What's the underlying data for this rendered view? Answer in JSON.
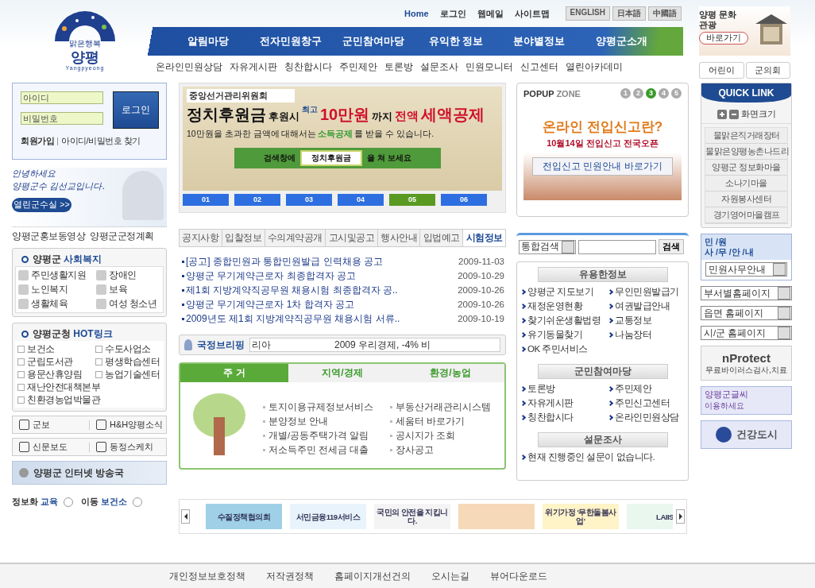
{
  "header": {
    "logo": {
      "slogan": "맑은행복",
      "name": "양평",
      "roman": "Yangpyeong"
    },
    "top_links": [
      "Home",
      "로그인",
      "웹메일",
      "사이트맵"
    ],
    "languages": [
      "ENGLISH",
      "日本語",
      "中國語"
    ],
    "main_menu": [
      "알림마당",
      "전자민원창구",
      "군민참여마당",
      "유익한 정보",
      "분야별정보",
      "양평군소개"
    ],
    "sub_menu": [
      "온라인민원상담",
      "자유게시판",
      "칭찬합시다",
      "주민제안",
      "토론방",
      "설문조사",
      "민원모니터",
      "신고센터",
      "열린아카데미"
    ],
    "culture": {
      "title": "양평 문화관광",
      "button": "바로가기"
    },
    "quick_buttons": [
      "어린이",
      "군의회"
    ]
  },
  "login": {
    "id_placeholder": "아이디",
    "pw_placeholder": "비밀번호",
    "button": "로그인",
    "join": "회원가입",
    "find": "아이디/비밀번호 찾기"
  },
  "mayor": {
    "line_1": "안녕하세요",
    "line_2": "양평군수 김선교입니다.",
    "button": "열린군수실 >>"
  },
  "promo_links": [
    "양평군홍보동영상",
    "양평군군정계획"
  ],
  "welfare": {
    "prefix": "양평군",
    "title": "사회복지",
    "items": [
      "주민생활지원",
      "장애인",
      "노인복지",
      "보육",
      "생활체육",
      "여성 청소년"
    ]
  },
  "hot_links": {
    "prefix": "양평군청",
    "title": "HOT링크",
    "items": [
      "보건소",
      "수도사업소",
      "군립도서관",
      "평생학습센터",
      "용문산휴양림",
      "농업기술센터",
      "재난안전대책본부",
      "친환경농업박물관"
    ]
  },
  "news_buttons": [
    "군보",
    "H&H양평소식",
    "신문보도",
    "동정스케치"
  ],
  "broadcast": "양평군 인터넷 방송국",
  "bottom_links": [
    {
      "prefix": "정보화",
      "label": "교육"
    },
    {
      "prefix": "이동",
      "label": "보건소"
    }
  ],
  "main_banner": {
    "org": "중앙선거관리위원회",
    "head_1": "정치후원금",
    "head_2": "후원시",
    "head_3": "최고",
    "head_4": "10만원",
    "head_5": "까지",
    "head_6": "전액",
    "head_7": "세액공제",
    "sub_1": "10만원을 초과한 금액에 대해서는",
    "sub_2": "소득공제",
    "sub_3": "를 받을 수 있습니다.",
    "search_1": "검색창에",
    "search_word": "정치후원금",
    "search_2": "을 쳐 보세요",
    "pages": [
      {
        "label": "01",
        "selected": false
      },
      {
        "label": "02",
        "selected": false
      },
      {
        "label": "03",
        "selected": false
      },
      {
        "label": "04",
        "selected": false
      },
      {
        "label": "05",
        "selected": true
      },
      {
        "label": "06",
        "selected": false
      }
    ]
  },
  "board": {
    "tabs": [
      {
        "label": "공지사항",
        "selected": false
      },
      {
        "label": "입찰정보",
        "selected": false
      },
      {
        "label": "수의계약공개",
        "selected": false
      },
      {
        "label": "고시및공고",
        "selected": false
      },
      {
        "label": "행사안내",
        "selected": false
      },
      {
        "label": "입법예고",
        "selected": false
      },
      {
        "label": "시험정보",
        "selected": true
      }
    ],
    "posts": [
      {
        "title": "[공고] 종합민원과 통합민원발급 인력채용 공고",
        "date": "2009-11-03"
      },
      {
        "title": "양평군 무기계약근로자 최종합격자 공고",
        "date": "2009-10-29"
      },
      {
        "title": "제1회 지방계약직공무원 채용시험 최종합격자 공..",
        "date": "2009-10-26"
      },
      {
        "title": "양평군 무기계약근로자 1차 합격자 공고",
        "date": "2009-10-26"
      },
      {
        "title": "2009년도 제1회 지방계약직공무원 채용시험 서류..",
        "date": "2009-10-19"
      }
    ]
  },
  "briefing": {
    "label": "국정브리핑",
    "ticker_1": "리아",
    "ticker_2": "2009 우리경제, -4% 비"
  },
  "themes": {
    "tabs": [
      {
        "label": "주 거",
        "selected": true
      },
      {
        "label": "지역/경제",
        "selected": false
      },
      {
        "label": "환경/농업",
        "selected": false
      }
    ],
    "links": [
      "토지이용규제정보서비스",
      "부동산거래관리시스템",
      "분양정보 안내",
      "세움터 바로가기",
      "개별/공동주택가격 알림",
      "공시지가 조회",
      "저소득주민 전세금 대출",
      "장사공고"
    ]
  },
  "popup": {
    "title_1": "POPUP",
    "title_2": "ZONE",
    "pages": [
      {
        "label": "1",
        "selected": false
      },
      {
        "label": "2",
        "selected": false
      },
      {
        "label": "3",
        "selected": true
      },
      {
        "label": "4",
        "selected": false
      },
      {
        "label": "5",
        "selected": false
      }
    ],
    "headline": "온라인 전입신고란?",
    "subline": "10월14일 전입신고 전국오픈",
    "link": "전입신고 민원안내 바로가기"
  },
  "search": {
    "scope": "통합검색",
    "button": "검색"
  },
  "info_sections": [
    {
      "title": "유용한정보",
      "links": [
        "양평군 지도보기",
        "무인민원발급기",
        "재정운영현황",
        "여권발급안내",
        "찾기쉬운생활법령",
        "교통정보",
        "유기동물찾기",
        "나눔장터",
        "OK 주민서비스"
      ]
    },
    {
      "title": "군민참여마당",
      "links": [
        "토론방",
        "주민제안",
        "자유게시판",
        "주민신고센터",
        "칭찬합시다",
        "온라인민원상담"
      ]
    },
    {
      "title": "설문조사",
      "links": [
        "현재 진행중인 설문이 없습니다."
      ]
    }
  ],
  "quick_link": {
    "title": "QUICK LINK",
    "zoom_label": "화면크기",
    "items": [
      "물맑은직거래장터",
      "물맑은양평농촌나드리",
      "양평군 정보화마을",
      "소나기마을",
      "자원봉사센터",
      "경기영어마을캠프"
    ]
  },
  "civil": {
    "title_1": "민 /원",
    "title_2": "사 /무 /안 /내",
    "select": "민원사무안내"
  },
  "selects": [
    "부서별홈페이지",
    "읍면 홈페이지",
    "시/군 홈페이지"
  ],
  "nprotect": {
    "name": "nProtect",
    "caption": "무료바이러스검사,치료"
  },
  "font_banner": {
    "title": "양평군글씨",
    "caption": "이용하세요"
  },
  "health_city": "건강도시",
  "banner_strip": [
    {
      "kind": "text",
      "text": "수질정책협의회"
    },
    {
      "kind": "text",
      "text": "서민금융119서비스"
    },
    {
      "kind": "text",
      "text": "국민의 안전을 지킵니다."
    },
    {
      "kind": "photo"
    },
    {
      "kind": "text",
      "text": "위기가정 '무한돌봄사업'"
    },
    {
      "kind": "text",
      "text": "LAIIS"
    }
  ],
  "footer": [
    "개인정보보호정책",
    "저작권정책",
    "홈페이지개선건의",
    "오시는길",
    "뷰어다운로드"
  ]
}
